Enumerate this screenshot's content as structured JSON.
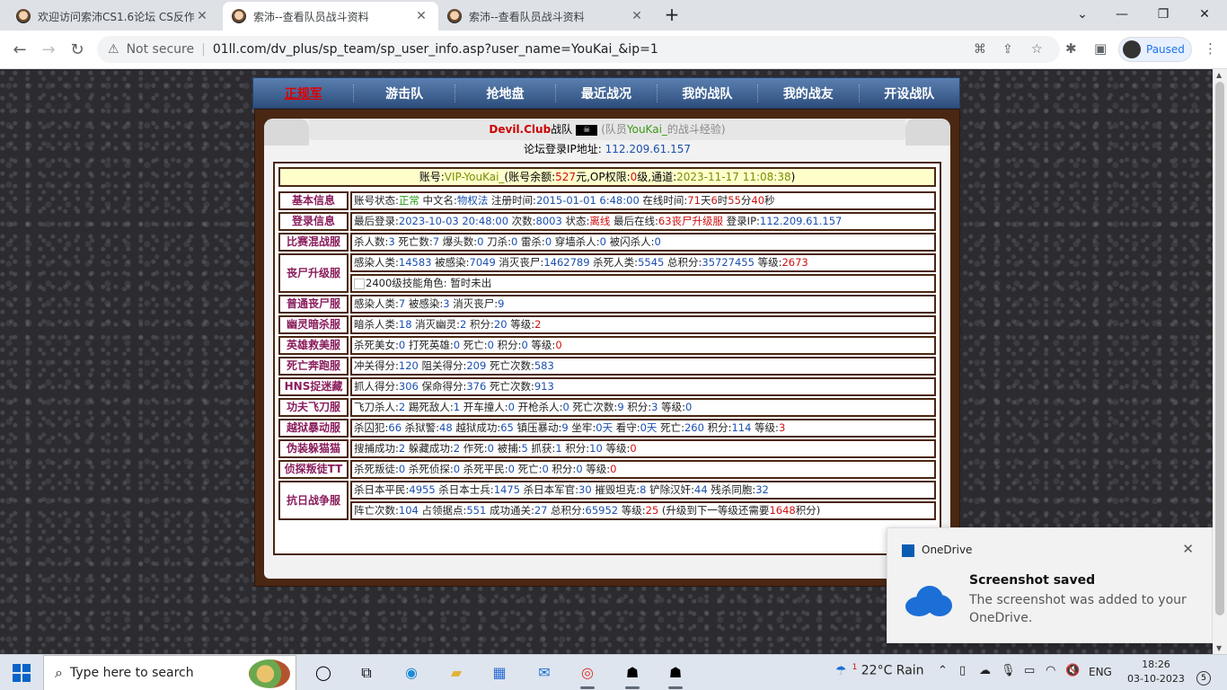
{
  "browser": {
    "tabs": [
      {
        "title": "欢迎访问索沛CS1.6论坛 CS反作弊...",
        "active": false
      },
      {
        "title": "索沛--查看队员战斗资料",
        "active": true
      },
      {
        "title": "索沛--查看队员战斗资料",
        "active": false
      }
    ],
    "new_tab": "+",
    "security_label": "Not secure",
    "url": "01ll.com/dv_plus/sp_team/sp_user_info.asp?user_name=YouKai_&ip=1",
    "profile_status": "Paused"
  },
  "nav": {
    "items": [
      "正规军",
      "游击队",
      "抢地盘",
      "最近战况",
      "我的战队",
      "我的战友",
      "开设战队"
    ]
  },
  "header": {
    "club": "Devil.Club",
    "team_suffix": "战队",
    "pirate_icon": "pirate-flag-icon",
    "paren_open": "(队员",
    "player": "YouKai_",
    "paren_close": "的战斗经验)",
    "ip_label": "论坛登录IP地址:",
    "ip": "112.209.61.157"
  },
  "account": {
    "label": "账号:",
    "vip": "VIP-YouKai_",
    "balance_label": "(账号余额:",
    "balance": "527",
    "balance_unit": "元",
    "op_label": ",OP权限:",
    "op": "0",
    "op_unit": "级",
    "channel_label": ",通道:",
    "channel": "2023-11-17 11:08:38",
    "close": ")"
  },
  "rows": [
    {
      "label": "基本信息",
      "lines": [
        [
          {
            "t": "账号状态:",
            "c": ""
          },
          {
            "t": "正常",
            "c": "g"
          },
          {
            "t": " 中文名:",
            "c": ""
          },
          {
            "t": "物权法",
            "c": "n"
          },
          {
            "t": " 注册时间:",
            "c": ""
          },
          {
            "t": "2015-01-01 6:48:00",
            "c": "n"
          },
          {
            "t": " 在线时间:",
            "c": ""
          },
          {
            "t": "71",
            "c": "r"
          },
          {
            "t": "天",
            "c": ""
          },
          {
            "t": "6",
            "c": "r"
          },
          {
            "t": "时",
            "c": ""
          },
          {
            "t": "55",
            "c": "r"
          },
          {
            "t": "分",
            "c": ""
          },
          {
            "t": "40",
            "c": "r"
          },
          {
            "t": "秒",
            "c": ""
          }
        ]
      ]
    },
    {
      "label": "登录信息",
      "lines": [
        [
          {
            "t": "最后登录:",
            "c": ""
          },
          {
            "t": "2023-10-03 20:48:00",
            "c": "n"
          },
          {
            "t": " 次数:",
            "c": ""
          },
          {
            "t": "8003",
            "c": "n"
          },
          {
            "t": " 状态:",
            "c": ""
          },
          {
            "t": "离线",
            "c": "r"
          },
          {
            "t": " 最后在线:",
            "c": ""
          },
          {
            "t": "63丧尸升级服",
            "c": "r"
          },
          {
            "t": " 登录IP:",
            "c": ""
          },
          {
            "t": "112.209.61.157",
            "c": "n"
          }
        ]
      ]
    },
    {
      "label": "比赛混战服",
      "lines": [
        [
          {
            "t": "杀人数:",
            "c": ""
          },
          {
            "t": "3",
            "c": "n"
          },
          {
            "t": " 死亡数:",
            "c": ""
          },
          {
            "t": "7",
            "c": "n"
          },
          {
            "t": " 爆头数:",
            "c": ""
          },
          {
            "t": "0",
            "c": "n"
          },
          {
            "t": " 刀杀:",
            "c": ""
          },
          {
            "t": "0",
            "c": "n"
          },
          {
            "t": " 雷杀:",
            "c": ""
          },
          {
            "t": "0",
            "c": "n"
          },
          {
            "t": " 穿墙杀人:",
            "c": ""
          },
          {
            "t": "0",
            "c": "n"
          },
          {
            "t": " 被闪杀人:",
            "c": ""
          },
          {
            "t": "0",
            "c": "n"
          }
        ]
      ]
    },
    {
      "label": "丧尸升级服",
      "lines": [
        [
          {
            "t": "感染人类:",
            "c": ""
          },
          {
            "t": "14583",
            "c": "n"
          },
          {
            "t": " 被感染:",
            "c": ""
          },
          {
            "t": "7049",
            "c": "n"
          },
          {
            "t": " 消灭丧尸:",
            "c": ""
          },
          {
            "t": "1462789",
            "c": "n"
          },
          {
            "t": " 杀死人类:",
            "c": ""
          },
          {
            "t": "5545",
            "c": "n"
          },
          {
            "t": " 总积分:",
            "c": ""
          },
          {
            "t": "35727455",
            "c": "n"
          },
          {
            "t": " 等级:",
            "c": ""
          },
          {
            "t": "2673",
            "c": "r"
          }
        ],
        [
          {
            "t": "2400级技能角色:",
            "c": "img"
          },
          {
            "t": " 暂时未出",
            "c": ""
          }
        ]
      ]
    },
    {
      "label": "普通丧尸服",
      "lines": [
        [
          {
            "t": "感染人类:",
            "c": ""
          },
          {
            "t": "7",
            "c": "n"
          },
          {
            "t": " 被感染:",
            "c": ""
          },
          {
            "t": "3",
            "c": "n"
          },
          {
            "t": " 消灭丧尸:",
            "c": ""
          },
          {
            "t": "9",
            "c": "n"
          }
        ]
      ]
    },
    {
      "label": "幽灵暗杀服",
      "lines": [
        [
          {
            "t": "暗杀人类:",
            "c": ""
          },
          {
            "t": "18",
            "c": "n"
          },
          {
            "t": " 消灭幽灵:",
            "c": ""
          },
          {
            "t": "2",
            "c": "n"
          },
          {
            "t": " 积分:",
            "c": ""
          },
          {
            "t": "20",
            "c": "n"
          },
          {
            "t": " 等级:",
            "c": ""
          },
          {
            "t": "2",
            "c": "r"
          }
        ]
      ]
    },
    {
      "label": "英雄救美服",
      "lines": [
        [
          {
            "t": "杀死美女:",
            "c": ""
          },
          {
            "t": "0",
            "c": "n"
          },
          {
            "t": " 打死英雄:",
            "c": ""
          },
          {
            "t": "0",
            "c": "n"
          },
          {
            "t": " 死亡:",
            "c": ""
          },
          {
            "t": "0",
            "c": "n"
          },
          {
            "t": " 积分:",
            "c": ""
          },
          {
            "t": "0",
            "c": "n"
          },
          {
            "t": " 等级:",
            "c": ""
          },
          {
            "t": "0",
            "c": "r"
          }
        ]
      ]
    },
    {
      "label": "死亡奔跑服",
      "lines": [
        [
          {
            "t": "冲关得分:",
            "c": ""
          },
          {
            "t": "120",
            "c": "n"
          },
          {
            "t": " 阻关得分:",
            "c": ""
          },
          {
            "t": "209",
            "c": "n"
          },
          {
            "t": " 死亡次数:",
            "c": ""
          },
          {
            "t": "583",
            "c": "n"
          }
        ]
      ]
    },
    {
      "label": "HNS捉迷藏",
      "lines": [
        [
          {
            "t": "抓人得分:",
            "c": ""
          },
          {
            "t": "306",
            "c": "n"
          },
          {
            "t": " 保命得分:",
            "c": ""
          },
          {
            "t": "376",
            "c": "n"
          },
          {
            "t": " 死亡次数:",
            "c": ""
          },
          {
            "t": "913",
            "c": "n"
          }
        ]
      ]
    },
    {
      "label": "功夫飞刀服",
      "lines": [
        [
          {
            "t": "飞刀杀人:",
            "c": ""
          },
          {
            "t": "2",
            "c": "n"
          },
          {
            "t": " 踢死敌人:",
            "c": ""
          },
          {
            "t": "1",
            "c": "n"
          },
          {
            "t": " 开车撞人:",
            "c": ""
          },
          {
            "t": "0",
            "c": "n"
          },
          {
            "t": " 开枪杀人:",
            "c": ""
          },
          {
            "t": "0",
            "c": "n"
          },
          {
            "t": " 死亡次数:",
            "c": ""
          },
          {
            "t": "9",
            "c": "n"
          },
          {
            "t": " 积分:",
            "c": ""
          },
          {
            "t": "3",
            "c": "n"
          },
          {
            "t": " 等级:",
            "c": ""
          },
          {
            "t": "0",
            "c": "n"
          }
        ]
      ]
    },
    {
      "label": "越狱暴动服",
      "lines": [
        [
          {
            "t": "杀囚犯:",
            "c": ""
          },
          {
            "t": "66",
            "c": "n"
          },
          {
            "t": " 杀狱警:",
            "c": ""
          },
          {
            "t": "48",
            "c": "n"
          },
          {
            "t": " 越狱成功:",
            "c": ""
          },
          {
            "t": "65",
            "c": "n"
          },
          {
            "t": " 镇压暴动:",
            "c": ""
          },
          {
            "t": "9",
            "c": "n"
          },
          {
            "t": " 坐牢:",
            "c": ""
          },
          {
            "t": "0天",
            "c": "n"
          },
          {
            "t": " 看守:",
            "c": ""
          },
          {
            "t": "0天",
            "c": "n"
          },
          {
            "t": " 死亡:",
            "c": ""
          },
          {
            "t": "260",
            "c": "n"
          },
          {
            "t": " 积分:",
            "c": ""
          },
          {
            "t": "114",
            "c": "n"
          },
          {
            "t": " 等级:",
            "c": ""
          },
          {
            "t": "3",
            "c": "r"
          }
        ]
      ]
    },
    {
      "label": "伪装躲猫猫",
      "lines": [
        [
          {
            "t": "搜捕成功:",
            "c": ""
          },
          {
            "t": "2",
            "c": "n"
          },
          {
            "t": " 躲藏成功:",
            "c": ""
          },
          {
            "t": "2",
            "c": "n"
          },
          {
            "t": " 作死:",
            "c": ""
          },
          {
            "t": "0",
            "c": "n"
          },
          {
            "t": " 被捕:",
            "c": ""
          },
          {
            "t": "5",
            "c": "n"
          },
          {
            "t": " 抓获:",
            "c": ""
          },
          {
            "t": "1",
            "c": "n"
          },
          {
            "t": " 积分:",
            "c": ""
          },
          {
            "t": "10",
            "c": "n"
          },
          {
            "t": " 等级:",
            "c": ""
          },
          {
            "t": "0",
            "c": "r"
          }
        ]
      ]
    },
    {
      "label": "侦探叛徒TT",
      "lines": [
        [
          {
            "t": "杀死叛徒:",
            "c": ""
          },
          {
            "t": "0",
            "c": "n"
          },
          {
            "t": " 杀死侦探:",
            "c": ""
          },
          {
            "t": "0",
            "c": "n"
          },
          {
            "t": " 杀死平民:",
            "c": ""
          },
          {
            "t": "0",
            "c": "n"
          },
          {
            "t": " 死亡:",
            "c": ""
          },
          {
            "t": "0",
            "c": "n"
          },
          {
            "t": " 积分:",
            "c": ""
          },
          {
            "t": "0",
            "c": "n"
          },
          {
            "t": " 等级:",
            "c": ""
          },
          {
            "t": "0",
            "c": "r"
          }
        ]
      ]
    },
    {
      "label": "抗日战争服",
      "lines": [
        [
          {
            "t": "杀日本平民:",
            "c": ""
          },
          {
            "t": "4955",
            "c": "n"
          },
          {
            "t": " 杀日本士兵:",
            "c": ""
          },
          {
            "t": "1475",
            "c": "n"
          },
          {
            "t": " 杀日本军官:",
            "c": ""
          },
          {
            "t": "30",
            "c": "n"
          },
          {
            "t": " 摧毁坦克:",
            "c": ""
          },
          {
            "t": "8",
            "c": "n"
          },
          {
            "t": " 铲除汉奸:",
            "c": ""
          },
          {
            "t": "44",
            "c": "n"
          },
          {
            "t": " 残杀同胞:",
            "c": ""
          },
          {
            "t": "32",
            "c": "n"
          }
        ],
        [
          {
            "t": "阵亡次数:",
            "c": ""
          },
          {
            "t": "104",
            "c": "n"
          },
          {
            "t": " 占领据点:",
            "c": ""
          },
          {
            "t": "551",
            "c": "n"
          },
          {
            "t": " 成功通关:",
            "c": ""
          },
          {
            "t": "27",
            "c": "n"
          },
          {
            "t": " 总积分:",
            "c": ""
          },
          {
            "t": "65952",
            "c": "n"
          },
          {
            "t": " 等级:",
            "c": ""
          },
          {
            "t": "25",
            "c": "r"
          },
          {
            "t": " (升级到下一等级还需要",
            "c": ""
          },
          {
            "t": "1648",
            "c": "r"
          },
          {
            "t": "积分)",
            "c": ""
          }
        ]
      ]
    }
  ],
  "toast": {
    "app": "OneDrive",
    "title": "Screenshot saved",
    "body": "The screenshot was added to your OneDrive."
  },
  "taskbar": {
    "search_placeholder": "Type here to search",
    "temperature": "22°C",
    "weather": "Rain",
    "weather_badge": "1",
    "lang": "ENG",
    "time": "18:26",
    "date": "03-10-2023",
    "notification_count": "5"
  },
  "colors": {
    "nav_bg": "#3b5f92",
    "frame": "#4a2712",
    "label_text": "#8a1d5c",
    "value_blue": "#1b4fb0",
    "value_red": "#d01010",
    "account_bg": "#ffffcc"
  }
}
